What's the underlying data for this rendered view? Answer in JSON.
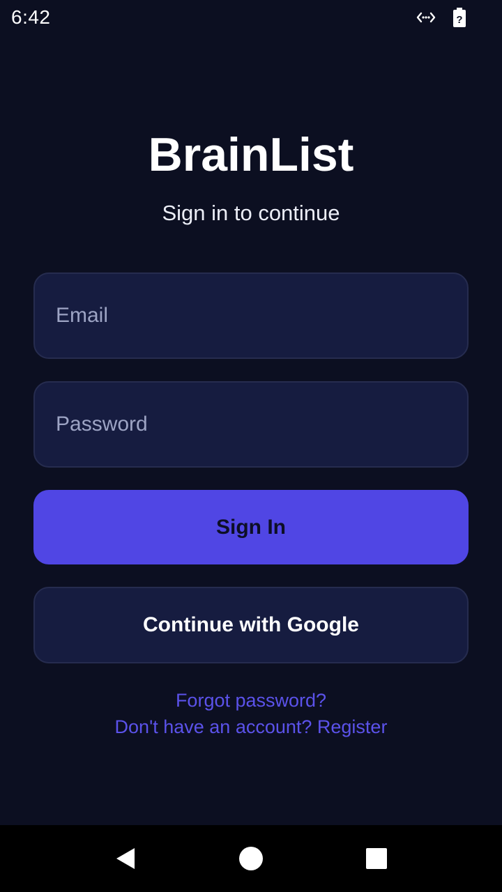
{
  "status_bar": {
    "time": "6:42",
    "icons": [
      "data-transfer-icon",
      "battery-unknown-icon"
    ],
    "battery_glyph": "?"
  },
  "app": {
    "title": "BrainList",
    "subtitle": "Sign in to continue"
  },
  "form": {
    "email": {
      "placeholder": "Email",
      "value": ""
    },
    "password": {
      "placeholder": "Password",
      "value": ""
    },
    "signin_label": "Sign In",
    "google_label": "Continue with Google"
  },
  "links": {
    "forgot": "Forgot password?",
    "register": "Don't have an account? Register"
  },
  "nav_bar": {
    "icons": [
      "back-icon",
      "home-icon",
      "recents-icon"
    ]
  },
  "colors": {
    "background": "#0c0f21",
    "field_background": "#161c40",
    "field_border": "#262c4f",
    "accent": "#5046e4",
    "link": "#5b52ea",
    "placeholder": "#9da4c4"
  }
}
